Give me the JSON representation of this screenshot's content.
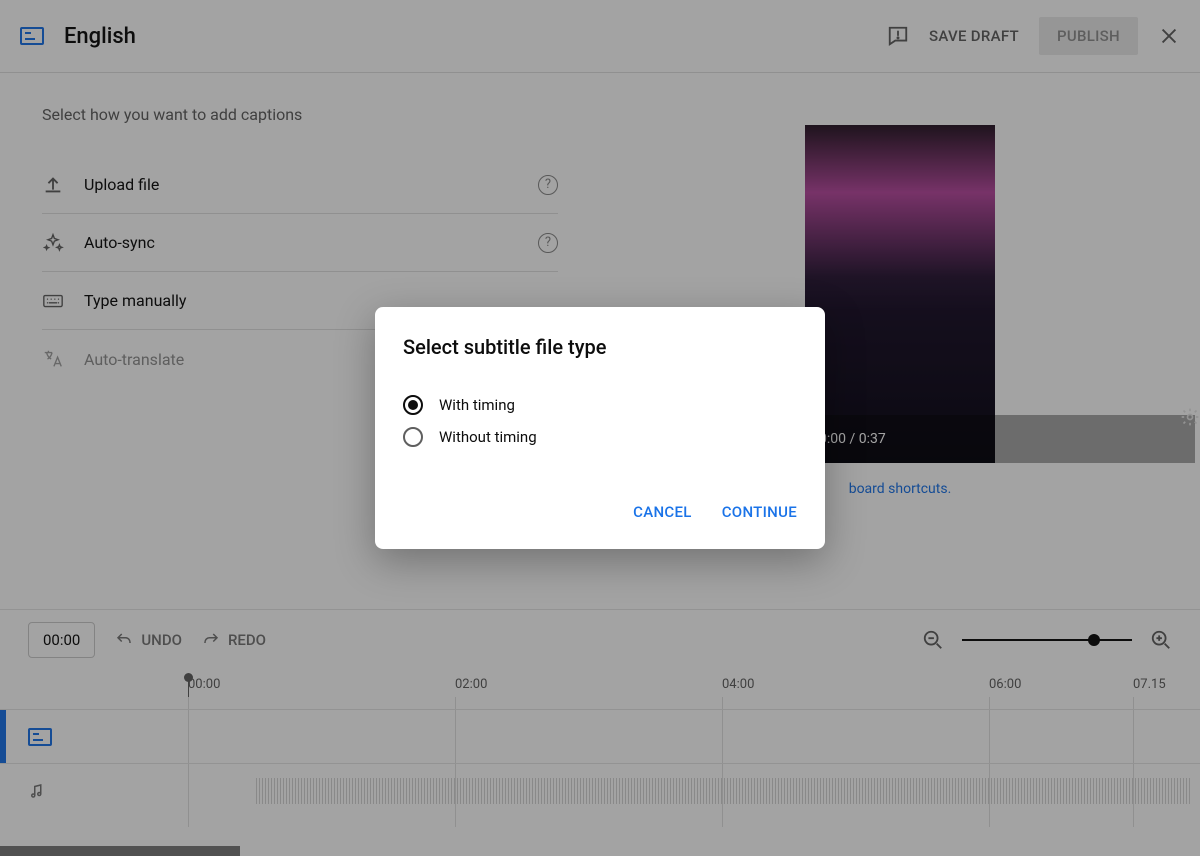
{
  "header": {
    "title": "English",
    "save_draft": "SAVE DRAFT",
    "publish": "PUBLISH"
  },
  "left_panel": {
    "prompt": "Select how you want to add captions",
    "options": [
      {
        "label": "Upload file",
        "icon": "upload-icon",
        "help": true
      },
      {
        "label": "Auto-sync",
        "icon": "sparkle-icon",
        "help": true
      },
      {
        "label": "Type manually",
        "icon": "keyboard-icon",
        "help": false
      },
      {
        "label": "Auto-translate",
        "icon": "translate-icon",
        "help": false,
        "disabled": true
      }
    ]
  },
  "video": {
    "time": "0:00 / 0:37",
    "shortcuts": "board shortcuts."
  },
  "timeline": {
    "current": "00:00",
    "undo": "UNDO",
    "redo": "REDO",
    "ticks": [
      "00:00",
      "02:00",
      "04:00",
      "06:00",
      "07.15"
    ]
  },
  "dialog": {
    "title": "Select subtitle file type",
    "opt1": "With timing",
    "opt2": "Without timing",
    "cancel": "CANCEL",
    "continue": "CONTINUE"
  }
}
